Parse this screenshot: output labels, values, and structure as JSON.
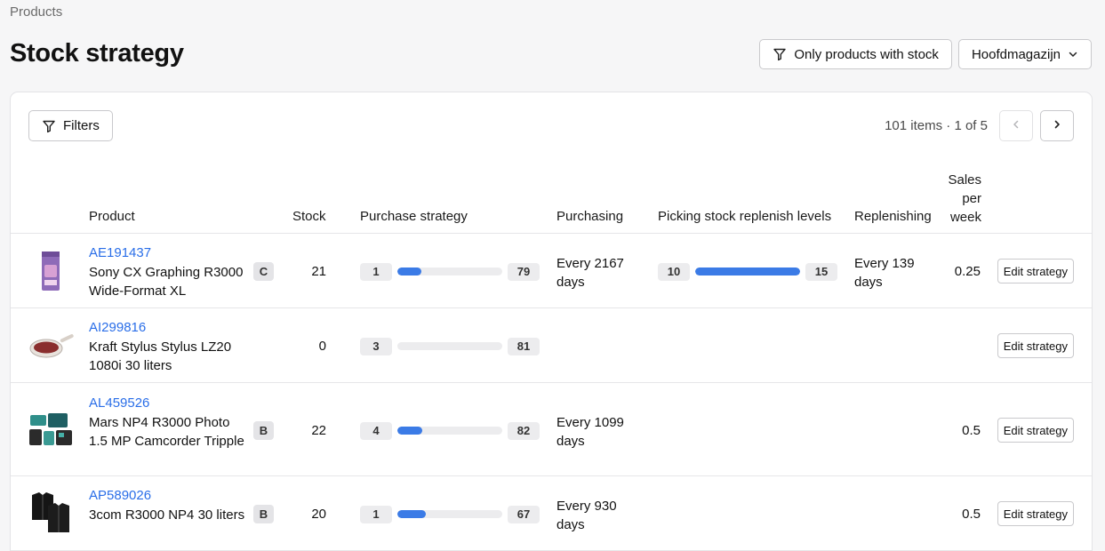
{
  "breadcrumb": "Products",
  "title": "Stock strategy",
  "header": {
    "only_stock_label": "Only products with stock",
    "warehouse_label": "Hoofdmagazijn"
  },
  "toolbar": {
    "filters_label": "Filters",
    "pager_text": "101 items · 1 of 5"
  },
  "columns": {
    "product": "Product",
    "stock": "Stock",
    "purchase_strategy": "Purchase strategy",
    "purchasing": "Purchasing",
    "picking_levels": "Picking stock replenish levels",
    "replenishing": "Replenishing",
    "sales_l1": "Sales",
    "sales_l2": "per",
    "sales_l3": "week"
  },
  "edit_label": "Edit strategy",
  "rows": [
    {
      "sku": "AE191437",
      "name": "Sony CX Graphing R3000 Wide-Format XL",
      "abc": "C",
      "stock": "21",
      "purchase_min": "1",
      "purchase_max": "79",
      "purchase_fill": 0.23,
      "purchasing": "Every 2167 days",
      "picking_min": "10",
      "picking_max": "15",
      "picking_fill": 1.0,
      "replenishing": "Every 139 days",
      "sales": "0.25",
      "thumb": "coffee-bag-icon"
    },
    {
      "sku": "AI299816",
      "name": "Kraft Stylus Stylus LZ20 1080i 30 liters",
      "abc": "",
      "stock": "0",
      "purchase_min": "3",
      "purchase_max": "81",
      "purchase_fill": 0.0,
      "purchasing": "",
      "picking_min": "",
      "picking_max": "",
      "replenishing": "",
      "sales": "",
      "thumb": "frying-pan-icon"
    },
    {
      "sku": "AL459526",
      "name": "Mars NP4 R3000 Photo 1.5 MP Camcorder Tripple",
      "abc": "B",
      "stock": "22",
      "purchase_min": "4",
      "purchase_max": "82",
      "purchase_fill": 0.24,
      "purchasing": "Every 1099 days",
      "picking_min": "",
      "picking_max": "",
      "replenishing": "",
      "sales": "0.5",
      "thumb": "power-tool-set-icon"
    },
    {
      "sku": "AP589026",
      "name": "3com R3000 NP4 30 liters",
      "abc": "B",
      "stock": "20",
      "purchase_min": "1",
      "purchase_max": "67",
      "purchase_fill": 0.27,
      "purchasing": "Every 930 days",
      "picking_min": "",
      "picking_max": "",
      "replenishing": "",
      "sales": "0.5",
      "thumb": "jackets-icon"
    }
  ]
}
